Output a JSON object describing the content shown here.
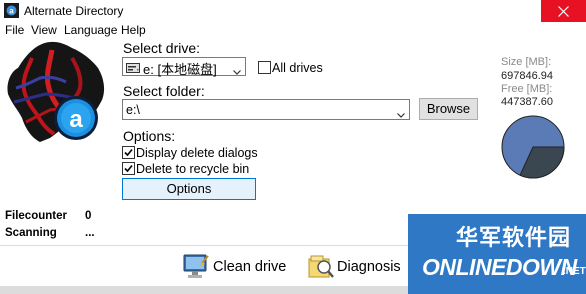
{
  "window": {
    "title": "Alternate Directory"
  },
  "menu": {
    "file": "File",
    "view": "View",
    "language": "Language",
    "help": "Help"
  },
  "drive": {
    "label": "Select drive:",
    "selected": "e: [本地磁盘]",
    "all_drives_label": "All drives",
    "all_drives_checked": false
  },
  "folder": {
    "label": "Select folder:",
    "value": "e:\\",
    "browse_label": "Browse"
  },
  "options": {
    "label": "Options:",
    "display_delete_dialogs": "Display delete dialogs",
    "display_delete_dialogs_checked": true,
    "delete_to_recycle_bin": "Delete to recycle bin",
    "delete_to_recycle_bin_checked": true,
    "button_label": "Options"
  },
  "disk": {
    "size_label": "Size [MB]:",
    "size_value": "697846.94",
    "free_label": "Free [MB]:",
    "free_value": "447387.60",
    "used_color": "#3a4750",
    "free_color": "#5a7bb5"
  },
  "status": {
    "filecounter_label": "Filecounter",
    "filecounter_value": "0",
    "scanning_label": "Scanning",
    "scanning_value": "..."
  },
  "toolbar": {
    "clean_drive": "Clean drive",
    "diagnosis": "Diagnosis"
  },
  "watermark": {
    "cn": "华军软件园",
    "en": "ONLINEDOWN",
    "suffix": ".NET"
  },
  "icons": {
    "app": "app-icon",
    "close": "close-icon",
    "disk": "disk-icon",
    "clean": "computer-clean-icon",
    "diagnosis": "diagnosis-icon"
  }
}
